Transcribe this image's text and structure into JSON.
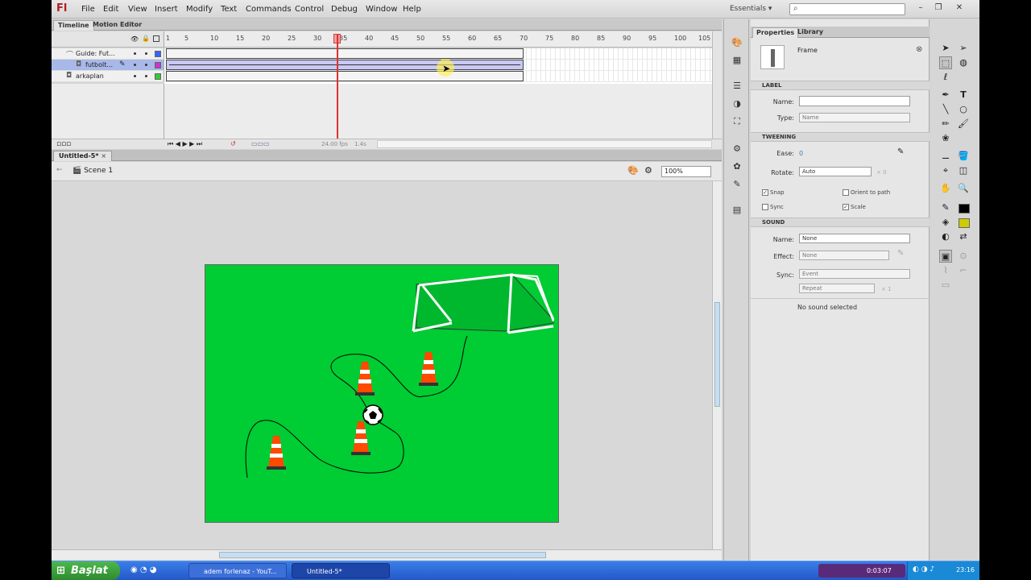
{
  "app": {
    "logo": "Fl",
    "menu": [
      "File",
      "Edit",
      "View",
      "Insert",
      "Modify",
      "Text",
      "Commands",
      "Control",
      "Debug",
      "Window",
      "Help"
    ],
    "workspace": "Essentials",
    "search_icon": "search-icon"
  },
  "timeline": {
    "tabs": [
      "Timeline",
      "Motion Editor"
    ],
    "ruler": [
      "1",
      "5",
      "10",
      "15",
      "20",
      "25",
      "30",
      "35",
      "40",
      "45",
      "50",
      "55",
      "60",
      "65",
      "70",
      "75",
      "80",
      "85",
      "90",
      "95",
      "100",
      "105"
    ],
    "layers": [
      {
        "name": "Guide: Fut...",
        "color": "#3366ff",
        "selected": false
      },
      {
        "name": "futbolt...",
        "color": "#cc33cc",
        "selected": true
      },
      {
        "name": "arkaplan",
        "color": "#33cc33",
        "selected": false
      }
    ],
    "fps_value": "24.00",
    "fps_unit": "fps",
    "time_value": "1.4s",
    "current_frame": 35
  },
  "document": {
    "tab_title": "Untitled-5*",
    "scene": "Scene 1",
    "zoom": "100%"
  },
  "properties": {
    "tabs": [
      "Properties",
      "Library"
    ],
    "type": "Frame",
    "label_section": "LABEL",
    "name_label": "Name:",
    "name_value": "",
    "type_label": "Type:",
    "type_value": "Name",
    "tweening_section": "TWEENING",
    "ease_label": "Ease:",
    "ease_value": "0",
    "rotate_label": "Rotate:",
    "rotate_value": "Auto",
    "rotate_count": "× 0",
    "snap": "Snap",
    "orient": "Orient to path",
    "sync_cb": "Sync",
    "scale": "Scale",
    "sound_section": "SOUND",
    "sound_name_label": "Name:",
    "sound_name_value": "None",
    "effect_label": "Effect:",
    "effect_value": "None",
    "sync_label": "Sync:",
    "sync_value": "Event",
    "repeat_value": "Repeat",
    "repeat_count": "× 1",
    "status": "No sound selected"
  },
  "taskbar": {
    "start": "Başlat",
    "tasks": [
      "adem forlenaz - YouT...",
      "Untitled-5*"
    ],
    "clock": "23:16",
    "recorder": "0:03:07"
  },
  "colors": {
    "stage": "#00cc33",
    "stroke": "#000000",
    "fill": "#cccc00"
  }
}
